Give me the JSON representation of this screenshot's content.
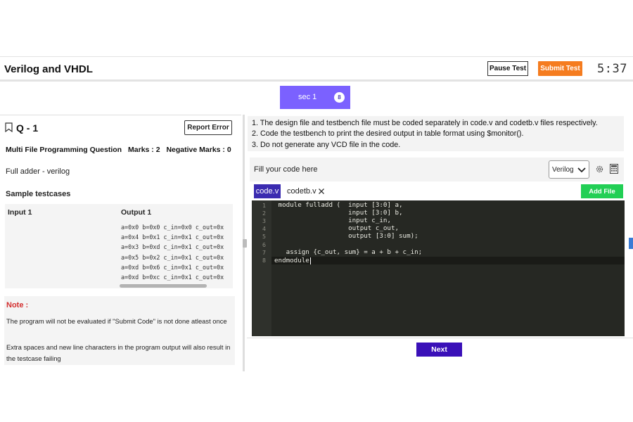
{
  "header": {
    "title": "Verilog and VHDL",
    "pause_label": "Pause Test",
    "submit_label": "Submit Test",
    "timer": "5:37"
  },
  "section": {
    "label": "sec 1",
    "count": "8",
    "color": "#7b61ff"
  },
  "question": {
    "title": "Q - 1",
    "report_label": "Report Error",
    "type": "Multi File Programming Question",
    "marks": "Marks : 2",
    "negative_marks": "Negative Marks : 0",
    "description": "Full adder - verilog",
    "sample_title": "Sample testcases",
    "input_label": "Input 1",
    "output_label": "Output 1",
    "output_lines": [
      "a=0x0 b=0x0 c_in=0x0 c_out=0x",
      "a=0x4 b=0x1 c_in=0x1 c_out=0x",
      "a=0x3 b=0xd c_in=0x1 c_out=0x",
      "a=0x5 b=0x2 c_in=0x1 c_out=0x",
      "a=0xd b=0x6 c_in=0x1 c_out=0x",
      "a=0xd b=0xc c_in=0x1 c_out=0x"
    ]
  },
  "note": {
    "title": "Note :",
    "p1": "The program will not be evaluated if \"Submit Code\" is not done atleast once",
    "p2": "Extra spaces and new line characters in the program output will also result in the testcase failing"
  },
  "instructions": [
    "1. The design file and testbench file must be coded separately in code.v and codetb.v files respectively.",
    "2. Code the testbench to print the desired output in table format using $monitor().",
    "3. Do not generate any VCD file in the code."
  ],
  "editor": {
    "fill_label": "Fill your code here",
    "language": "Verilog",
    "tabs": [
      "code.v",
      "codetb.v"
    ],
    "add_file_label": "Add File",
    "line_numbers": [
      "1",
      "2",
      "3",
      "4",
      "5",
      "6",
      "7",
      "8"
    ],
    "code_lines": [
      " module fulladd (  input [3:0] a,",
      "                   input [3:0] b,",
      "                   input c_in,",
      "                   output c_out,",
      "                   output [3:0] sum);",
      "",
      "   assign {c_out, sum} = a + b + c_in;",
      "endmodule"
    ]
  },
  "footer": {
    "next_label": "Next"
  },
  "icons": [
    "bookmark-icon",
    "chevron-down-icon",
    "gear-icon",
    "calculator-icon",
    "close-icon"
  ]
}
